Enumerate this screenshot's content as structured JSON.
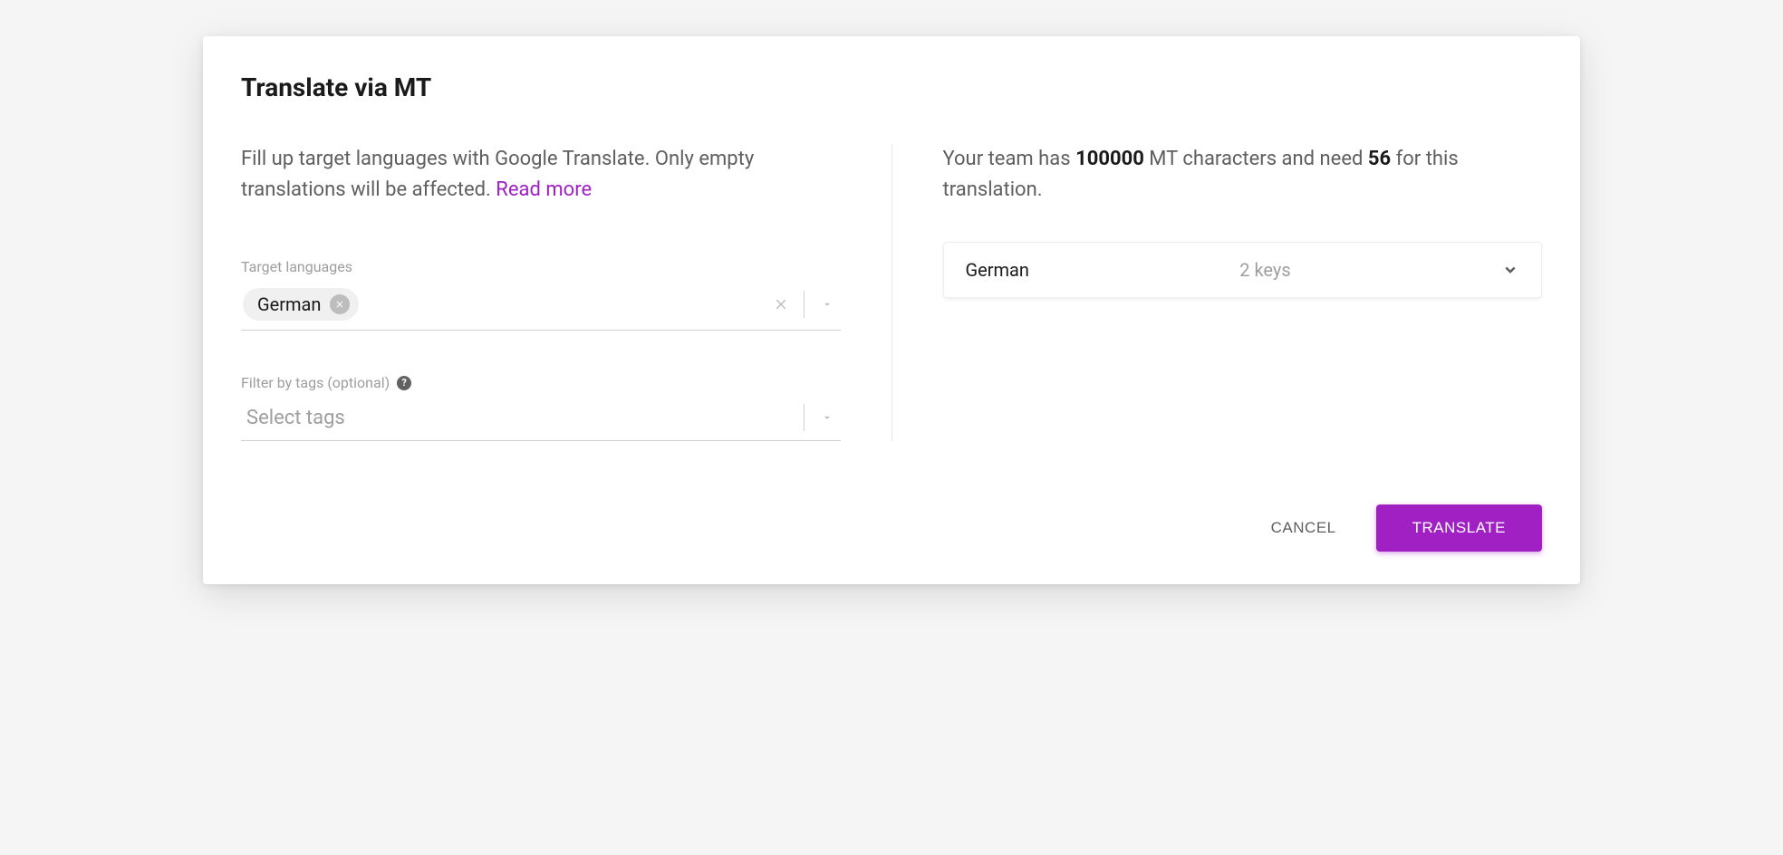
{
  "modal": {
    "title": "Translate via MT",
    "left": {
      "description_prefix": "Fill up target languages with Google Translate. Only empty translations will be affected. ",
      "read_more": "Read more",
      "target_languages_label": "Target languages",
      "selected_language": "German",
      "filter_tags_label": "Filter by tags (optional)",
      "filter_tags_placeholder": "Select tags"
    },
    "right": {
      "text_prefix": "Your team has ",
      "mt_characters": "100000",
      "text_middle": " MT characters and need ",
      "needed": "56",
      "text_suffix": " for this translation.",
      "summary": {
        "language": "German",
        "keys": "2 keys"
      }
    },
    "actions": {
      "cancel": "CANCEL",
      "translate": "TRANSLATE"
    }
  }
}
